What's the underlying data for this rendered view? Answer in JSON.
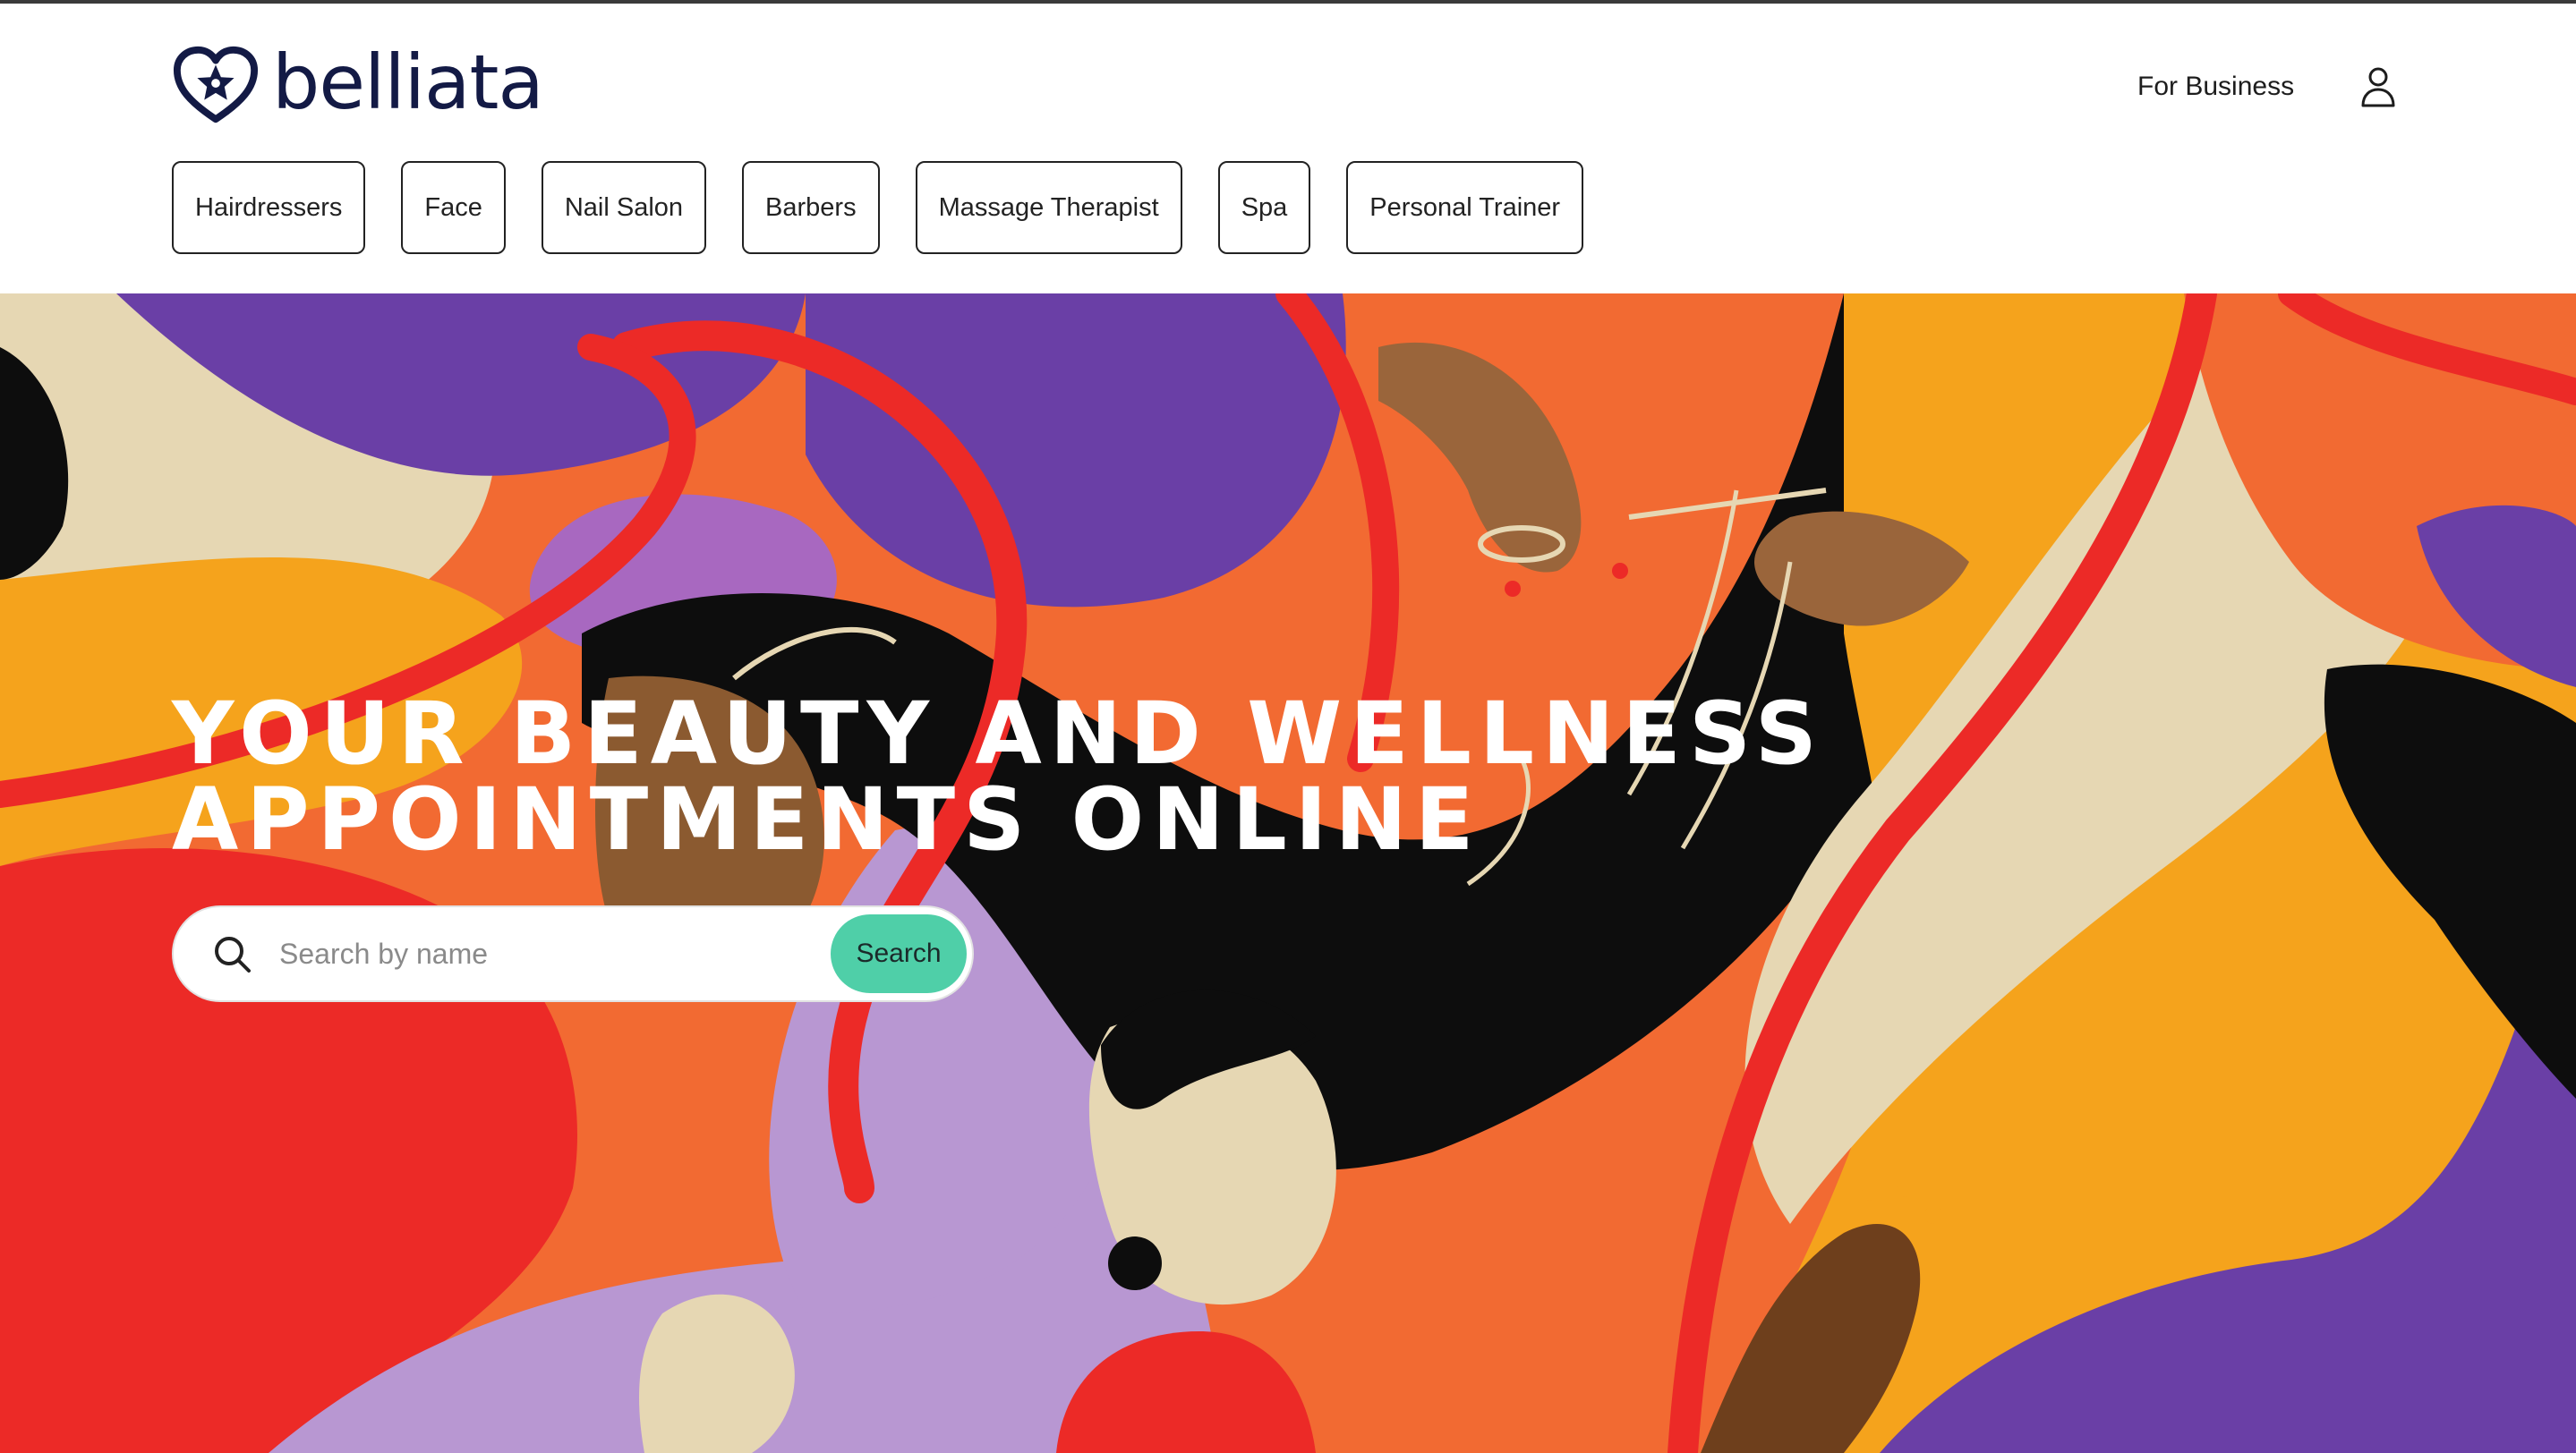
{
  "brand": {
    "name": "belliata",
    "logo_icon": "heart-star-logo-icon",
    "color": "#131a45"
  },
  "header": {
    "for_business_label": "For Business",
    "user_icon": "user-icon"
  },
  "categories": [
    {
      "label": "Hairdressers"
    },
    {
      "label": "Face"
    },
    {
      "label": "Nail Salon"
    },
    {
      "label": "Barbers"
    },
    {
      "label": "Massage Therapist"
    },
    {
      "label": "Spa"
    },
    {
      "label": "Personal Trainer"
    }
  ],
  "hero": {
    "title_line1": "YOUR BEAUTY AND WELLNESS",
    "title_line2": "APPOINTMENTS ONLINE",
    "palette": {
      "orange": "#f26a32",
      "yellow": "#f5a31c",
      "red": "#ec2a27",
      "purple": "#6a3fa6",
      "lavender": "#b897d2",
      "cream": "#e6d7b3",
      "black": "#0d0d0d",
      "brown": "#8b5a30"
    }
  },
  "search": {
    "placeholder": "Search by name",
    "button_label": "Search",
    "button_color": "#4fcfa8",
    "icon": "search-icon"
  }
}
